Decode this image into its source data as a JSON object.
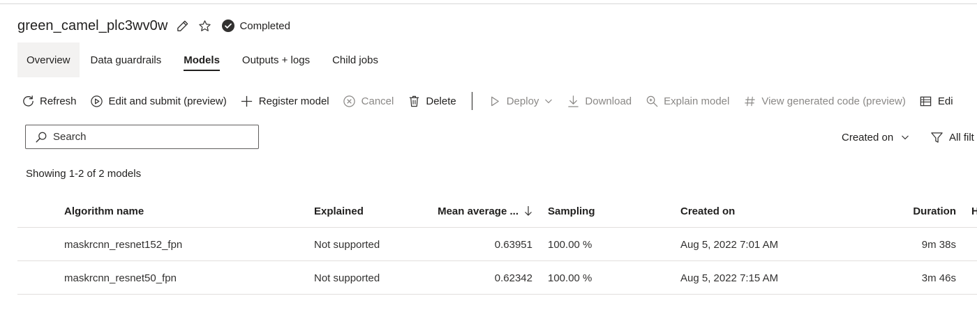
{
  "job": {
    "title": "green_camel_plc3wv0w",
    "status": "Completed"
  },
  "tabs": [
    {
      "label": "Overview"
    },
    {
      "label": "Data guardrails"
    },
    {
      "label": "Models"
    },
    {
      "label": "Outputs + logs"
    },
    {
      "label": "Child jobs"
    }
  ],
  "toolbar": {
    "refresh": "Refresh",
    "edit_submit": "Edit and submit (preview)",
    "register_model": "Register model",
    "cancel": "Cancel",
    "delete": "Delete",
    "deploy": "Deploy",
    "download": "Download",
    "explain_model": "Explain model",
    "view_code": "View generated code (preview)",
    "edit_cut": "Edi"
  },
  "search": {
    "placeholder": "Search",
    "value": ""
  },
  "sort": {
    "selected": "Created on"
  },
  "filters": {
    "label": "All filt"
  },
  "summary": "Showing 1-2 of 2 models",
  "table": {
    "columns": {
      "algorithm": "Algorithm name",
      "explained": "Explained",
      "mean_avg": "Mean average ...",
      "sampling": "Sampling",
      "created": "Created on",
      "duration": "Duration",
      "extra": "H"
    },
    "rows": [
      {
        "algorithm": "maskrcnn_resnet152_fpn",
        "explained": "Not supported",
        "mean_avg": "0.63951",
        "sampling": "100.00 %",
        "created": "Aug 5, 2022 7:01 AM",
        "duration": "9m 38s"
      },
      {
        "algorithm": "maskrcnn_resnet50_fpn",
        "explained": "Not supported",
        "mean_avg": "0.62342",
        "sampling": "100.00 %",
        "created": "Aug 5, 2022 7:15 AM",
        "duration": "3m 46s"
      }
    ]
  },
  "icons": {
    "edit": "pencil-icon",
    "favorite": "star-icon",
    "status": "check-circle-icon",
    "refresh": "refresh-icon",
    "edit_submit": "play-circle-icon",
    "register": "plus-icon",
    "cancel": "cancel-circle-icon",
    "delete": "trash-icon",
    "deploy": "play-icon",
    "download": "download-icon",
    "explain": "zoom-icon",
    "code": "hash-icon",
    "edit_cut": "table-edit-icon",
    "search": "search-icon",
    "filter": "filter-icon"
  },
  "colors": {
    "status_check": "#323130",
    "active_tab_bg": "#f3f2f1",
    "disabled_text": "#8a8886"
  }
}
